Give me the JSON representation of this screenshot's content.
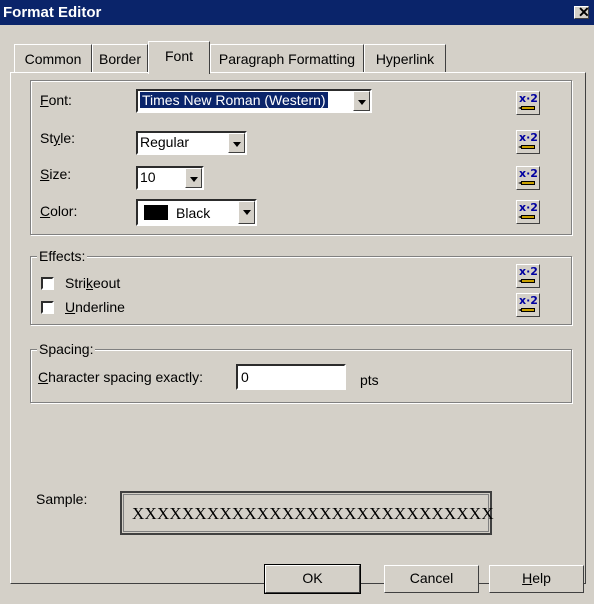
{
  "window": {
    "title": "Format Editor",
    "close_glyph": "✕"
  },
  "tabs": [
    {
      "label": "Common"
    },
    {
      "label": "Border"
    },
    {
      "label": "Font",
      "active": true
    },
    {
      "label": "Paragraph Formatting"
    },
    {
      "label": "Hyperlink"
    }
  ],
  "font_group": {
    "font": {
      "label_pre": "",
      "label_u": "F",
      "label_post": "ont:",
      "value": "Times New Roman (Western)"
    },
    "style": {
      "label_pre": "St",
      "label_u": "y",
      "label_post": "le:",
      "value": "Regular"
    },
    "size": {
      "label_pre": "",
      "label_u": "S",
      "label_post": "ize:",
      "value": "10"
    },
    "color": {
      "label_pre": "",
      "label_u": "C",
      "label_post": "olor:",
      "value": "Black",
      "swatch": "#000000"
    },
    "formula_button_icon": "formula-x2-icon"
  },
  "effects": {
    "title": "Effects:",
    "strikeout": {
      "label_pre": "Stri",
      "label_u": "k",
      "label_post": "eout",
      "checked": false
    },
    "underline": {
      "label_pre": "",
      "label_u": "U",
      "label_post": "nderline",
      "checked": false
    }
  },
  "spacing": {
    "title": "Spacing:",
    "char_spacing": {
      "label_pre": "",
      "label_u": "C",
      "label_post": "haracter spacing exactly:",
      "value": "0",
      "unit": "pts"
    }
  },
  "sample": {
    "label": "Sample:",
    "text": "XXXXXXXXXXXXXXXXXXXXXXXXXXXXX"
  },
  "buttons": {
    "ok": "OK",
    "cancel": "Cancel",
    "help_u": "H",
    "help_post": "elp"
  },
  "colors": {
    "title_bar": "#0a246a",
    "face": "#d4d0c8",
    "highlight": "#0a246a"
  }
}
